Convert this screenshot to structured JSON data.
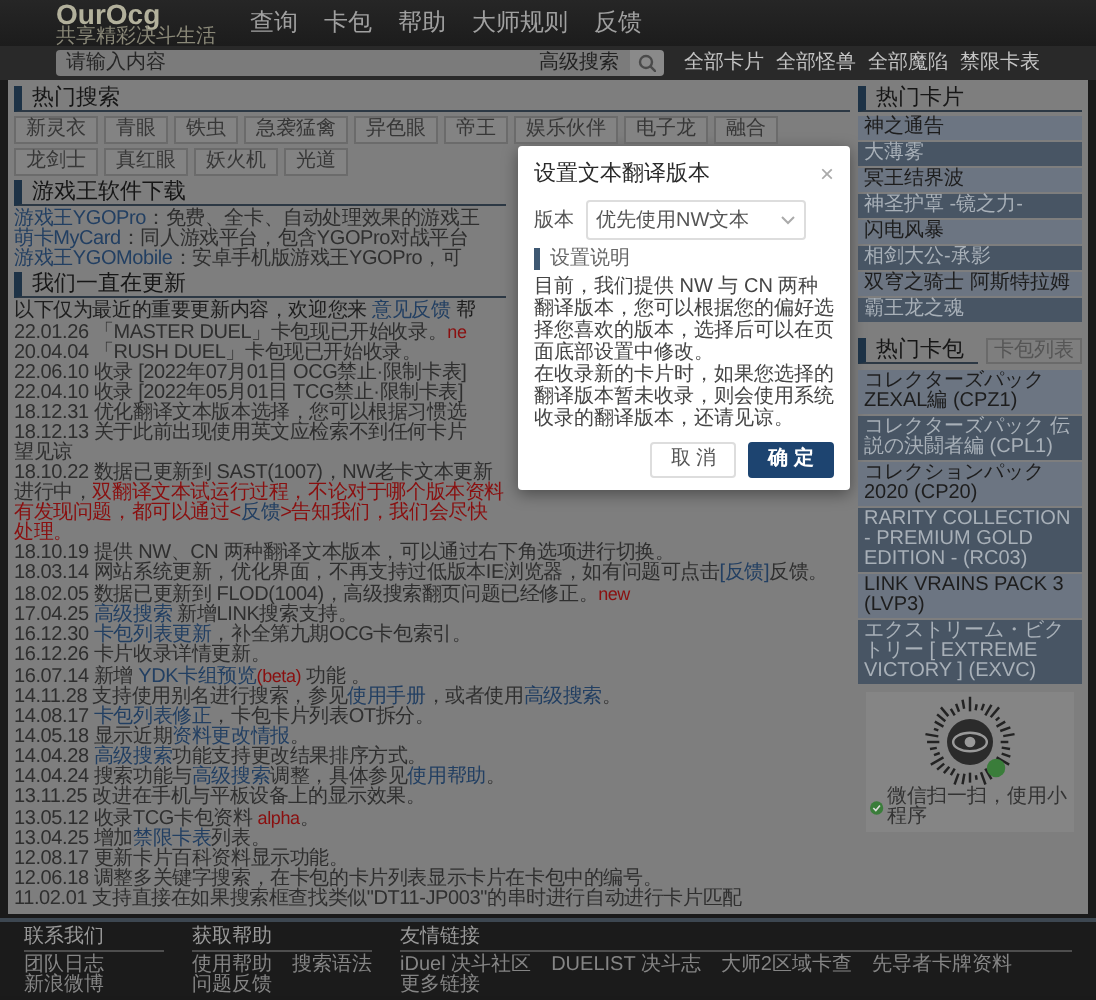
{
  "header": {
    "logo": "OurOcg",
    "tagline": "共享精彩决斗生活",
    "nav": [
      "查询",
      "卡包",
      "帮助",
      "大师规则",
      "反馈"
    ]
  },
  "search": {
    "placeholder": "请输入内容",
    "advanced_label": "高级搜索",
    "quick_links": [
      "全部卡片",
      "全部怪兽",
      "全部魔陷",
      "禁限卡表"
    ]
  },
  "hot_search": {
    "title": "热门搜索",
    "tags": [
      "新灵衣",
      "青眼",
      "铁虫",
      "急袭猛禽",
      "异色眼",
      "帝王",
      "娱乐伙伴",
      "电子龙",
      "融合",
      "龙剑士",
      "真红眼",
      "妖火机",
      "光道"
    ]
  },
  "downloads": {
    "title": "游戏王软件下载",
    "items": [
      {
        "segments": [
          {
            "kind": "link",
            "text": "游戏王YGOPro"
          },
          {
            "kind": "plain",
            "text": "：免费、全卡、自动处理效果的游戏王"
          }
        ]
      },
      {
        "segments": [
          {
            "kind": "link",
            "text": "萌卡MyCard"
          },
          {
            "kind": "plain",
            "text": "：同人游戏平台，包含YGOPro对战平台"
          }
        ]
      },
      {
        "segments": [
          {
            "kind": "link",
            "text": "游戏王YGOMobile"
          },
          {
            "kind": "plain",
            "text": "：安卓手机版游戏王YGOPro，可"
          }
        ]
      }
    ]
  },
  "updates": {
    "title": "我们一直在更新",
    "intro": [
      {
        "kind": "plain",
        "text": "以下仅为最近的重要更新内容，欢迎您来 "
      },
      {
        "kind": "link",
        "text": "意见反馈"
      },
      {
        "kind": "plain",
        "text": " 帮"
      }
    ],
    "entries": [
      {
        "segments": [
          {
            "kind": "plain",
            "text": "22.01.26 「MASTER DUEL」卡包现已开始收录。"
          },
          {
            "kind": "badge",
            "text": "ne"
          }
        ]
      },
      {
        "segments": [
          {
            "kind": "plain",
            "text": "20.04.04 「RUSH DUEL」卡包现已开始收录。"
          }
        ]
      },
      {
        "segments": [
          {
            "kind": "plain",
            "text": "22.06.10 收录 [2022年07月01日 OCG禁止·限制卡表]"
          }
        ]
      },
      {
        "segments": [
          {
            "kind": "plain",
            "text": "22.04.10 收录 [2022年05月01日 TCG禁止·限制卡表]"
          }
        ]
      },
      {
        "segments": [
          {
            "kind": "plain",
            "text": "18.12.31 优化翻译文本版本选择，您可以根据习惯选"
          }
        ]
      },
      {
        "segments": [
          {
            "kind": "plain",
            "text": "18.12.13 关于此前出现使用英文应检索不到任何卡片"
          }
        ]
      },
      {
        "segments": [
          {
            "kind": "plain",
            "text": "望见谅"
          }
        ]
      },
      {
        "segments": [
          {
            "kind": "plain",
            "text": "18.10.22 数据已更新到 SAST(1007)，NW老卡文本更新进行中，"
          },
          {
            "kind": "alert",
            "text": "双翻译文本试运行过程，不论对于哪个版本资料有发现问题，都可以通过<"
          },
          {
            "kind": "link",
            "text": "反馈"
          },
          {
            "kind": "alert",
            "text": ">告知我们，我们会尽快处理。"
          }
        ]
      },
      {
        "segments": [
          {
            "kind": "plain",
            "text": "18.10.19 提供 NW、CN 两种翻译文本版本，可以通过右下角选项进行切换。"
          }
        ]
      },
      {
        "segments": [
          {
            "kind": "plain",
            "text": "18.03.14 网站系统更新，优化界面，不再支持过低版本IE浏览器，如有问题可点击"
          },
          {
            "kind": "link",
            "text": "[反馈]"
          },
          {
            "kind": "plain",
            "text": "反馈。"
          }
        ]
      },
      {
        "segments": [
          {
            "kind": "plain",
            "text": "18.02.05 数据已更新到 FLOD(1004)，高级搜索翻页问题已经修正。"
          },
          {
            "kind": "badge",
            "text": "new"
          }
        ]
      },
      {
        "segments": [
          {
            "kind": "plain",
            "text": "17.04.25 "
          },
          {
            "kind": "link",
            "text": "高级搜索"
          },
          {
            "kind": "plain",
            "text": " 新增LINK搜索支持。"
          }
        ]
      },
      {
        "segments": [
          {
            "kind": "plain",
            "text": "16.12.30 "
          },
          {
            "kind": "link",
            "text": "卡包列表更新"
          },
          {
            "kind": "plain",
            "text": "，补全第九期OCG卡包索引。"
          }
        ]
      },
      {
        "segments": [
          {
            "kind": "plain",
            "text": "16.12.26 卡片收录详情更新。"
          }
        ]
      },
      {
        "segments": [
          {
            "kind": "plain",
            "text": "16.07.14 新增 "
          },
          {
            "kind": "link",
            "text": "YDK卡组预览"
          },
          {
            "kind": "badge",
            "text": "(beta)"
          },
          {
            "kind": "plain",
            "text": " 功能 。"
          }
        ]
      },
      {
        "segments": [
          {
            "kind": "plain",
            "text": "14.11.28 支持使用别名进行搜索，参见"
          },
          {
            "kind": "link",
            "text": "使用手册"
          },
          {
            "kind": "plain",
            "text": "，或者使用"
          },
          {
            "kind": "link",
            "text": "高级搜索"
          },
          {
            "kind": "plain",
            "text": "。"
          }
        ]
      },
      {
        "segments": [
          {
            "kind": "plain",
            "text": "14.08.17 "
          },
          {
            "kind": "link",
            "text": "卡包列表修正"
          },
          {
            "kind": "plain",
            "text": "，卡包卡片列表OT拆分。"
          }
        ]
      },
      {
        "segments": [
          {
            "kind": "plain",
            "text": "14.05.18 显示近期"
          },
          {
            "kind": "link",
            "text": "资料更改情报"
          },
          {
            "kind": "plain",
            "text": "。"
          }
        ]
      },
      {
        "segments": [
          {
            "kind": "plain",
            "text": "14.04.28 "
          },
          {
            "kind": "link",
            "text": "高级搜索"
          },
          {
            "kind": "plain",
            "text": "功能支持更改结果排序方式。"
          }
        ]
      },
      {
        "segments": [
          {
            "kind": "plain",
            "text": "14.04.24 搜索功能与"
          },
          {
            "kind": "link",
            "text": "高级搜索"
          },
          {
            "kind": "plain",
            "text": "调整，具体参见"
          },
          {
            "kind": "link",
            "text": "使用帮助"
          },
          {
            "kind": "plain",
            "text": "。"
          }
        ]
      },
      {
        "segments": [
          {
            "kind": "plain",
            "text": "13.11.25 改进在手机与平板设备上的显示效果。"
          }
        ]
      },
      {
        "segments": [
          {
            "kind": "plain",
            "text": "13.05.12 收录TCG卡包资料 "
          },
          {
            "kind": "badge",
            "text": "alpha"
          },
          {
            "kind": "plain",
            "text": "。"
          }
        ]
      },
      {
        "segments": [
          {
            "kind": "plain",
            "text": "13.04.25 增加"
          },
          {
            "kind": "link",
            "text": "禁限卡表"
          },
          {
            "kind": "plain",
            "text": "列表。"
          }
        ]
      },
      {
        "segments": [
          {
            "kind": "plain",
            "text": "12.08.17 更新卡片百科资料显示功能。"
          }
        ]
      },
      {
        "segments": [
          {
            "kind": "plain",
            "text": "12.06.18 调整多关键字搜索，在卡包的卡片列表显示卡片在卡包中的编号。"
          }
        ]
      },
      {
        "segments": [
          {
            "kind": "plain",
            "text": "11.02.01 支持直接在如果搜索框查找类似\"DT11-JP003\"的串时进行自动进行卡片匹配"
          }
        ]
      }
    ]
  },
  "dialog": {
    "title": "设置文本翻译版本",
    "close": "×",
    "field_label": "版本",
    "select_value": "优先使用NW文本",
    "section_title": "设置说明",
    "paragraphs": [
      "目前，我们提供 NW 与 CN 两种翻译版本，您可以根据您的偏好选择您喜欢的版本，选择后可以在页面底部设置中修改。",
      "在收录新的卡片时，如果您选择的翻译版本暂未收录，则会使用系统收录的翻译版本，还请见谅。"
    ],
    "buttons": [
      {
        "label": "取 消",
        "kind": "secondary"
      },
      {
        "label": "确 定",
        "kind": "primary"
      }
    ]
  },
  "sidebar": {
    "hot_cards": {
      "title": "热门卡片",
      "items": [
        "神之通告",
        "大薄雾",
        "冥王结界波",
        "神圣护罩 -镜之力-",
        "闪电风暴",
        "相剑大公-承影",
        "双穹之骑士 阿斯特拉姆",
        "霸王龙之魂"
      ]
    },
    "hot_packs": {
      "title": "热门卡包",
      "list_button": "卡包列表",
      "items": [
        "コレクターズパック ZEXAL編 (CPZ1)",
        "コレクターズパック 伝説の決闘者編 (CPL1)",
        "コレクションパック 2020 (CP20)",
        "RARITY COLLECTION - PREMIUM GOLD EDITION - (RC03)",
        "LINK VRAINS PACK 3 (LVP3)",
        "エクストリーム・ビクトリー [ EXTREME VICTORY ] (EXVC)"
      ]
    },
    "qr": {
      "caption": "微信扫一扫，使用小程序"
    }
  },
  "footer": {
    "groups": [
      {
        "title": "联系我们",
        "links": [
          "团队日志",
          "新浪微博"
        ]
      },
      {
        "title": "获取帮助",
        "links": [
          "使用帮助",
          "搜索语法",
          "问题反馈"
        ]
      },
      {
        "title": "友情链接",
        "links": [
          "iDuel 决斗社区",
          "DUELIST 决斗志",
          "大师2区域卡查",
          "先导者卡牌资料",
          "更多链接"
        ]
      }
    ]
  }
}
